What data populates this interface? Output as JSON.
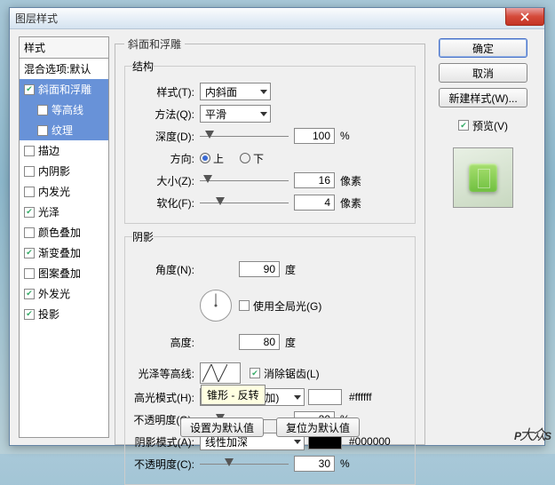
{
  "title": "图层样式",
  "left": {
    "head": "样式",
    "blend": "混合选项:默认",
    "bevel": "斜面和浮雕",
    "contour": "等高线",
    "texture": "纹理",
    "stroke": "描边",
    "innerShadow": "内阴影",
    "innerGlow": "内发光",
    "satin": "光泽",
    "colorOverlay": "颜色叠加",
    "gradOverlay": "渐变叠加",
    "patternOverlay": "图案叠加",
    "outerGlow": "外发光",
    "dropShadow": "投影"
  },
  "panel": {
    "mainLegend": "斜面和浮雕",
    "structLegend": "结构",
    "shadowLegend": "阴影",
    "styleLabel": "样式(T):",
    "styleVal": "内斜面",
    "techLabel": "方法(Q):",
    "techVal": "平滑",
    "depthLabel": "深度(D):",
    "depthVal": "100",
    "depthUnit": "%",
    "dirLabel": "方向:",
    "dirUp": "上",
    "dirDown": "下",
    "sizeLabel": "大小(Z):",
    "sizeVal": "16",
    "sizeUnit": "像素",
    "softLabel": "软化(F):",
    "softVal": "4",
    "softUnit": "像素",
    "angleLabel": "角度(N):",
    "angleVal": "90",
    "angleUnit": "度",
    "globalLight": "使用全局光(G)",
    "altLabel": "高度:",
    "altVal": "80",
    "altUnit": "度",
    "glossLabel": "光泽等高线:",
    "glossTooltip": "锥形 - 反转",
    "antialias": "消除锯齿(L)",
    "hiLabel": "高光模式(H):",
    "hiMode": "线性减淡 (添加)",
    "hiColor": "#ffffff",
    "hiHex": "#ffffff",
    "hiOpLabel": "不透明度(O):",
    "hiOpVal": "20",
    "hiOpUnit": "%",
    "shLabel": "阴影模式(A):",
    "shMode": "线性加深",
    "shColor": "#000000",
    "shHex": "#000000",
    "shOpLabel": "不透明度(C):",
    "shOpVal": "30",
    "shOpUnit": "%",
    "setDefault": "设置为默认值",
    "resetDefault": "复位为默认值"
  },
  "right": {
    "ok": "确定",
    "cancel": "取消",
    "newStyle": "新建样式(W)...",
    "preview": "预览(V)"
  },
  "watermark": "P",
  "watermark2": "大众",
  "watermark3": "S"
}
